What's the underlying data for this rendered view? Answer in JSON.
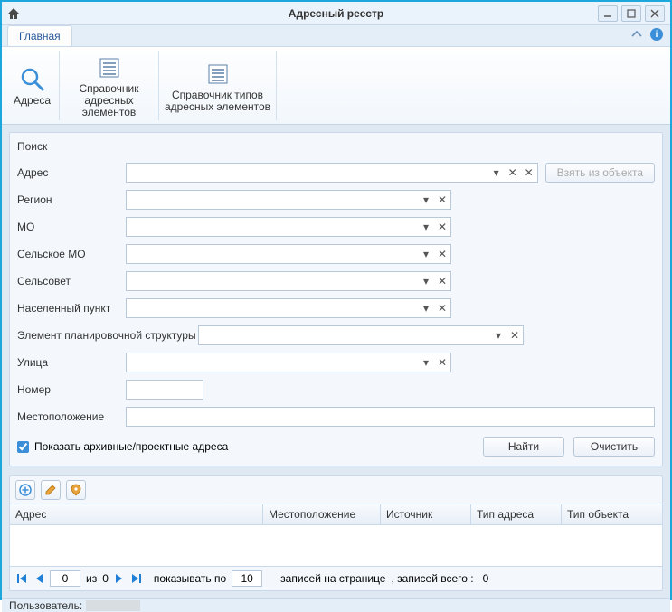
{
  "window": {
    "title": "Адресный реестр"
  },
  "tabs": {
    "main": "Главная"
  },
  "ribbon": {
    "addresses": "Адреса",
    "dict_elements_line1": "Справочник",
    "dict_elements_line2": "адресных элементов",
    "dict_types_line1": "Справочник типов",
    "dict_types_line2": "адресных элементов"
  },
  "search": {
    "panel_title": "Поиск",
    "address": "Адрес",
    "region": "Регион",
    "mo": "МО",
    "rural_mo": "Сельское МО",
    "selsovet": "Сельсовет",
    "settlement": "Населенный пункт",
    "planning_element": "Элемент планировочной структуры",
    "street": "Улица",
    "number": "Номер",
    "location": "Местоположение",
    "from_object_btn": "Взять из объекта",
    "show_archive_cb": "Показать архивные/проектные адреса",
    "find_btn": "Найти",
    "clear_btn": "Очистить"
  },
  "grid": {
    "columns": {
      "address": "Адрес",
      "location": "Местоположение",
      "source": "Источник",
      "addr_type": "Тип адреса",
      "obj_type": "Тип объекта"
    }
  },
  "pager": {
    "page_value": "0",
    "of_word": "из",
    "total_pages": "0",
    "show_per_label": "показывать по",
    "per_page_value": "10",
    "trailer1": "записей на странице",
    "trailer2": ", записей всего :",
    "total_records": "0"
  },
  "status": {
    "user_label": "Пользователь:"
  }
}
